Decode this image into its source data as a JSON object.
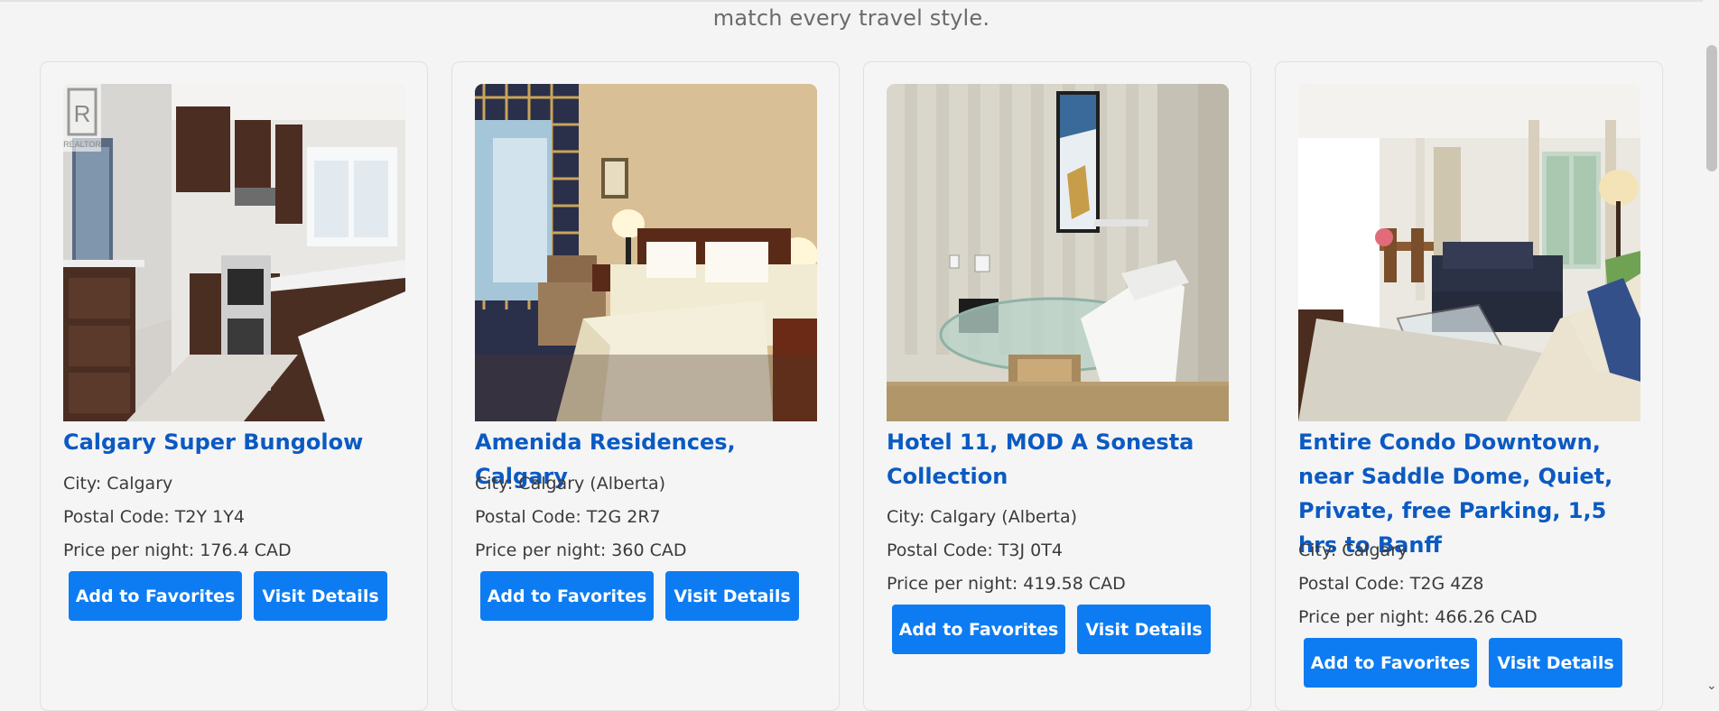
{
  "header": {
    "subtitle": "match every travel style."
  },
  "listings": [
    {
      "title": "Calgary Super Bungolow",
      "city": "City: Calgary",
      "postal": "Postal Code: T2Y 1Y4",
      "price": "Price per night: 176.4 CAD",
      "image": "kitchen-photo",
      "watermark": "REALTOR"
    },
    {
      "title": "Amenida Residences, Calgary",
      "city": "City: Calgary (Alberta)",
      "postal": "Postal Code: T2G 2R7",
      "price": "Price per night: 360 CAD",
      "image": "hotel-bedroom-photo"
    },
    {
      "title": "Hotel 11, MOD A Sonesta Collection",
      "city": "City: Calgary (Alberta)",
      "postal": "Postal Code: T3J 0T4",
      "price": "Price per night: 419.58 CAD",
      "image": "hotel-desk-photo"
    },
    {
      "title": "Entire Condo Downtown, near Saddle Dome, Quiet, Private, free Parking, 1,5 hrs to Banff",
      "city": "City: Calgary",
      "postal": "Postal Code: T2G 4Z8",
      "price": "Price per night: 466.26 CAD",
      "image": "condo-living-room-photo"
    }
  ],
  "buttons": {
    "favorites": "Add to Favorites",
    "details": "Visit Details"
  },
  "colors": {
    "accent": "#0d7cf2",
    "title": "#0b5ac2"
  }
}
